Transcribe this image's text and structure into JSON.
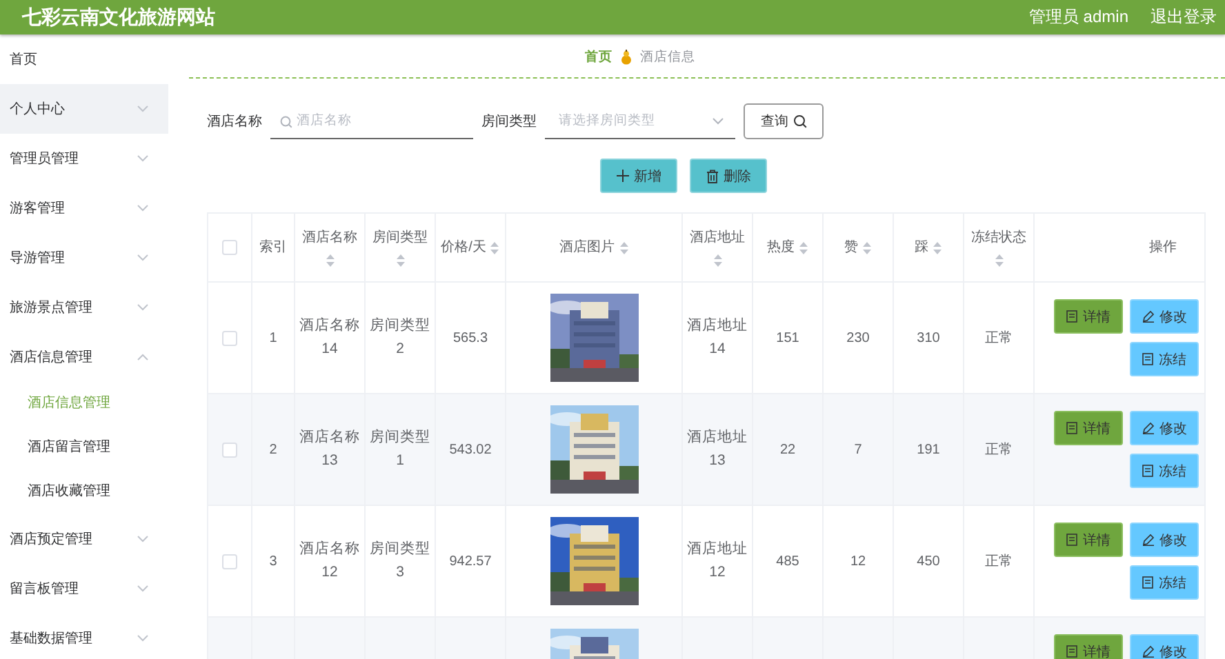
{
  "header": {
    "title": "七彩云南文化旅游网站",
    "user": "管理员 admin",
    "logout": "退出登录"
  },
  "sidebar": {
    "items": [
      {
        "label": "首页",
        "kind": "link",
        "hovered": false
      },
      {
        "label": "个人中心",
        "kind": "menu",
        "hovered": true,
        "expanded": false
      },
      {
        "label": "管理员管理",
        "kind": "menu",
        "hovered": false,
        "expanded": false
      },
      {
        "label": "游客管理",
        "kind": "menu",
        "hovered": false,
        "expanded": false
      },
      {
        "label": "导游管理",
        "kind": "menu",
        "hovered": false,
        "expanded": false
      },
      {
        "label": "旅游景点管理",
        "kind": "menu",
        "hovered": false,
        "expanded": false
      },
      {
        "label": "酒店信息管理",
        "kind": "menu",
        "hovered": false,
        "expanded": true,
        "children": [
          {
            "label": "酒店信息管理",
            "selected": true
          },
          {
            "label": "酒店留言管理",
            "selected": false
          },
          {
            "label": "酒店收藏管理",
            "selected": false
          }
        ]
      },
      {
        "label": "酒店预定管理",
        "kind": "menu",
        "hovered": false,
        "expanded": false
      },
      {
        "label": "留言板管理",
        "kind": "menu",
        "hovered": false,
        "expanded": false
      },
      {
        "label": "基础数据管理",
        "kind": "menu",
        "hovered": false,
        "expanded": false
      }
    ]
  },
  "breadcrumb": [
    "首页",
    "酒店信息"
  ],
  "search": {
    "fields": [
      {
        "label": "酒店名称",
        "placeholder": "酒店名称",
        "kind": "text"
      },
      {
        "label": "房间类型",
        "placeholder": "请选择房间类型",
        "kind": "select"
      }
    ],
    "button": "查询"
  },
  "toolbar": [
    {
      "label": "新增",
      "kind": "add"
    },
    {
      "label": "删除",
      "kind": "delete"
    }
  ],
  "table": {
    "header_checked": false,
    "columns": [
      {
        "label": "索引",
        "sortable": false
      },
      {
        "label": "酒店名称",
        "sortable": true
      },
      {
        "label": "房间类型",
        "sortable": true
      },
      {
        "label": "价格/天",
        "sortable": true
      },
      {
        "label": "酒店图片",
        "sortable": true
      },
      {
        "label": "酒店地址",
        "sortable": true
      },
      {
        "label": "热度",
        "sortable": true
      },
      {
        "label": "赞",
        "sortable": true
      },
      {
        "label": "踩",
        "sortable": true
      },
      {
        "label": "冻结状态",
        "sortable": true
      },
      {
        "label": "操作",
        "sortable": false
      }
    ],
    "rows": [
      {
        "checked": false,
        "cells": [
          "1",
          "酒店名称14",
          "房间类型2",
          "565.3",
          null,
          "酒店地址14",
          "151",
          "230",
          "310",
          "正常"
        ],
        "image": {
          "kind": "picture"
        },
        "actions": [
          {
            "label": "详情",
            "kind": "detail"
          },
          {
            "label": "修改",
            "kind": "edit"
          },
          {
            "label": "冻结",
            "kind": "freeze"
          }
        ]
      },
      {
        "checked": false,
        "cells": [
          "2",
          "酒店名称13",
          "房间类型1",
          "543.02",
          null,
          "酒店地址13",
          "22",
          "7",
          "191",
          "正常"
        ],
        "image": {
          "kind": "picture"
        },
        "actions": [
          {
            "label": "详情",
            "kind": "detail"
          },
          {
            "label": "修改",
            "kind": "edit"
          },
          {
            "label": "冻结",
            "kind": "freeze"
          }
        ]
      },
      {
        "checked": false,
        "cells": [
          "3",
          "酒店名称12",
          "房间类型3",
          "942.57",
          null,
          "酒店地址12",
          "485",
          "12",
          "450",
          "正常"
        ],
        "image": {
          "kind": "picture"
        },
        "actions": [
          {
            "label": "详情",
            "kind": "detail"
          },
          {
            "label": "修改",
            "kind": "edit"
          },
          {
            "label": "冻结",
            "kind": "freeze"
          }
        ]
      },
      {
        "cells": [],
        "image": {
          "kind": "picture"
        },
        "actions": [
          {
            "label": "详情",
            "kind": "detail"
          },
          {
            "label": "修改",
            "kind": "edit"
          }
        ]
      }
    ]
  }
}
